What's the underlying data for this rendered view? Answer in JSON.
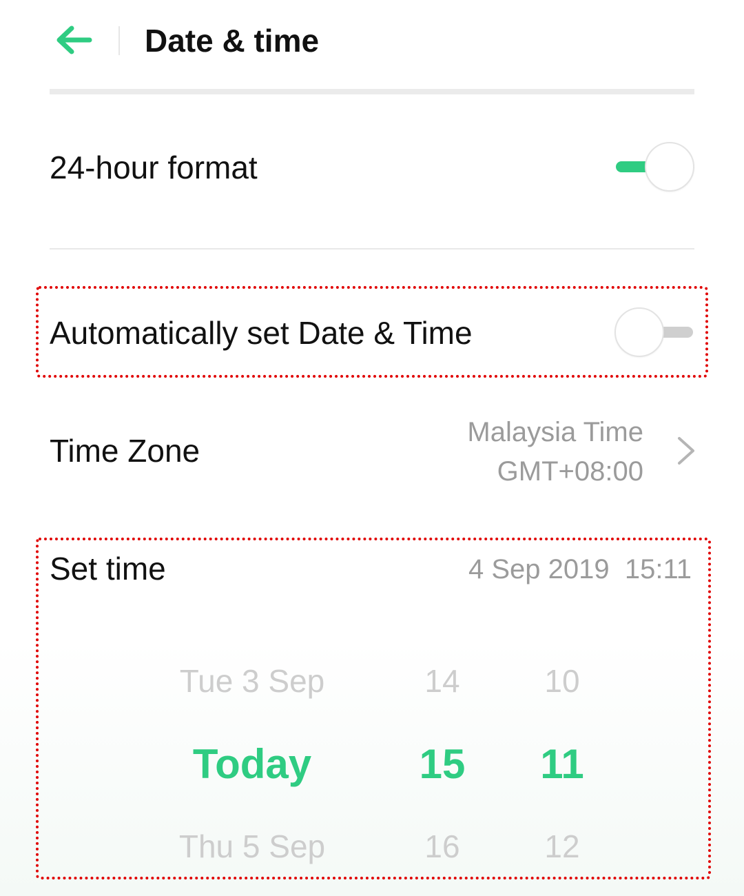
{
  "header": {
    "title": "Date & time",
    "back_icon": "arrow-left-icon",
    "accent_color": "#2fcc82"
  },
  "settings": {
    "hour_format": {
      "label": "24-hour format",
      "enabled": true
    },
    "auto_date_time": {
      "label": "Automatically set Date & Time",
      "enabled": false
    },
    "time_zone": {
      "label": "Time Zone",
      "name": "Malaysia Time",
      "offset": "GMT+08:00",
      "icon": "chevron-right-icon"
    },
    "set_time": {
      "label": "Set time",
      "value": "4 Sep 2019  15:11"
    }
  },
  "picker": {
    "date": {
      "prev": "Tue 3 Sep",
      "selected": "Today",
      "next": "Thu 5 Sep"
    },
    "hour": {
      "prev": "14",
      "selected": "15",
      "next": "16"
    },
    "minute": {
      "prev": "10",
      "selected": "11",
      "next": "12"
    }
  }
}
